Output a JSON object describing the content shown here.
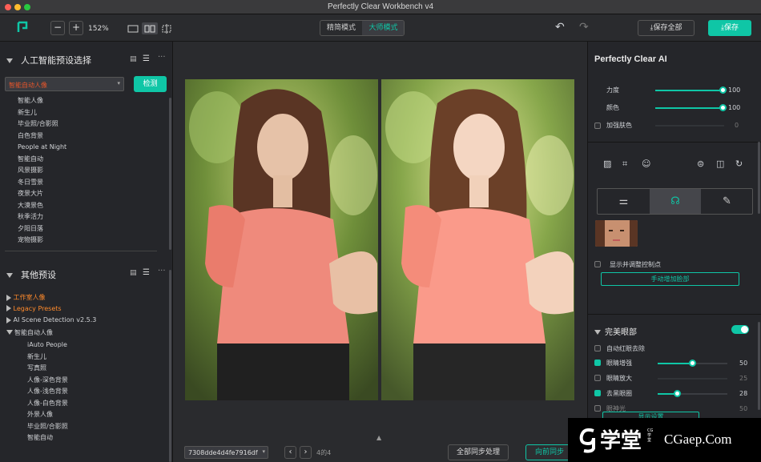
{
  "window": {
    "title": "Perfectly Clear Workbench v4"
  },
  "toolbar": {
    "zoom": "152%",
    "modes": [
      "精简模式",
      "大师模式"
    ],
    "save_all": "保存全部",
    "save": "保存"
  },
  "left": {
    "ai_section": "人工智能预设选择",
    "preset_select": "智能自动人像",
    "detect_btn": "检测",
    "ai_items": [
      "智能人像",
      "新生儿",
      "毕业照/合影照",
      "白色背景",
      "People at Night",
      "智能自动",
      "风景摄影",
      "冬日雪景",
      "夜景大片",
      "大漠景色",
      "秋季活力",
      "夕阳日落",
      "宠物摄影"
    ],
    "other_section": "其他预设",
    "groups": [
      {
        "label": "工作室人像",
        "highlight": true
      },
      {
        "label": "Legacy Presets",
        "highlight": true
      },
      {
        "label": "AI Scene Detection v2.5.3",
        "highlight": false
      },
      {
        "label": "智能自动人像",
        "highlight": false
      }
    ],
    "sub_items": [
      "iAuto People",
      "新生儿",
      "写真照",
      "人像-深色背景",
      "人像-浅色背景",
      "人像-白色背景",
      "外景人像",
      "毕业照/合影照",
      "智能自动"
    ]
  },
  "center": {
    "file_select": "7308dde4d4fe7916df",
    "page": "4的4",
    "sync_all": "全部同步处理",
    "sync_fwd": "向前同步"
  },
  "right": {
    "title": "Perfectly Clear AI",
    "sliders": [
      {
        "label": "力度",
        "value": 100,
        "checkbox": false
      },
      {
        "label": "颜色",
        "value": 100,
        "checkbox": false
      },
      {
        "label": "加强肤色",
        "value": 0,
        "checkbox": true,
        "checked": false
      }
    ],
    "show_control": "显示并调整控制点",
    "add_face": "手动增加脸部",
    "eyes_section": "完美眼部",
    "eye_rows": [
      {
        "label": "自动红眼去除",
        "checked": false,
        "value": null
      },
      {
        "label": "眼睛增强",
        "checked": true,
        "value": 50
      },
      {
        "label": "眼睛放大",
        "checked": false,
        "value": 25
      },
      {
        "label": "去黑眼圈",
        "checked": true,
        "value": 28
      },
      {
        "label": "眼神光",
        "checked": false,
        "value": 50
      }
    ],
    "bottom_btn": "显示设置"
  },
  "watermark": {
    "brand": "学堂",
    "small": "CG学堂",
    "url": "CGaep.Com"
  },
  "colors": {
    "accent": "#0fc6a6",
    "orange": "#ff8a2b",
    "select_red": "#e8552a"
  }
}
